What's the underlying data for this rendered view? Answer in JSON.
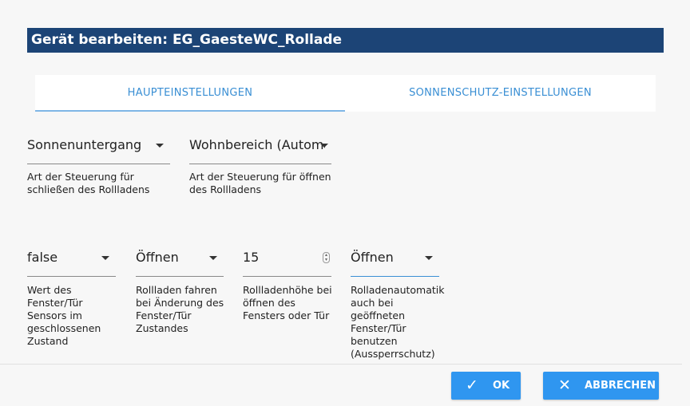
{
  "dialog": {
    "title": "Gerät bearbeiten: EG_GaesteWC_Rollade"
  },
  "tabs": [
    {
      "label": "HAUPTEINSTELLUNGEN"
    },
    {
      "label": "SONNENSCHUTZ-EINSTELLUNGEN"
    }
  ],
  "fields": {
    "close_control": {
      "value": "Sonnenuntergang",
      "helper": "Art der Steuerung für schließen des Rollladens"
    },
    "open_control": {
      "value": "Wohnbereich (Automatik",
      "helper": "Art der Steuerung für öffnen des Rollladens"
    },
    "window_closed_value": {
      "value": "false",
      "helper": "Wert des Fenster/Tür Sensors im geschlossenen Zustand"
    },
    "window_change_action": {
      "value": "Öffnen",
      "helper": "Rollladen fahren bei Änderung des Fenster/Tür Zustandes"
    },
    "window_open_height": {
      "value": "15",
      "helper": "Rollladenhöhe bei öffnen des Fensters oder Tür"
    },
    "lockout_protection": {
      "value": "Öffnen",
      "helper": "Rolladenautomatik auch bei geöffneten Fenster/Tür benutzen (Aussperrschutz)"
    }
  },
  "buttons": {
    "ok_label": "OK",
    "cancel_label": "ABBRECHEN"
  }
}
